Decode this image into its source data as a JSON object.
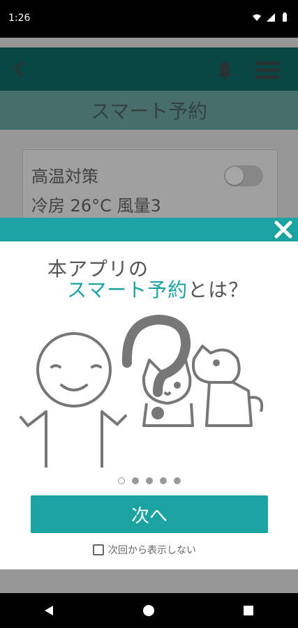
{
  "status_bar": {
    "time": "1:26",
    "icons": [
      "wifi-icon",
      "signal-icon",
      "battery-icon"
    ]
  },
  "topbar": {
    "color": "#0f6d69",
    "back_icon": "chevron-left-icon",
    "bell_icon": "bell-icon",
    "menu_icon": "hamburger-menu-icon"
  },
  "page": {
    "title": "スマート予約"
  },
  "card": {
    "title": "高温対策",
    "subtitle": "冷房 26°C 風量3",
    "toggle_on": false
  },
  "modal": {
    "header_color": "#1aa3a0",
    "close_icon": "close-icon",
    "line1": "本アプリの",
    "line2_accent": "スマート予約",
    "line2_rest": "とは？",
    "pages": 5,
    "current_page": 1,
    "next_button": "次へ",
    "dont_show_label": "次回から表示しない"
  },
  "nav_bar": {
    "back_icon": "triangle-back-icon",
    "home_icon": "circle-home-icon",
    "recents_icon": "square-recents-icon"
  }
}
